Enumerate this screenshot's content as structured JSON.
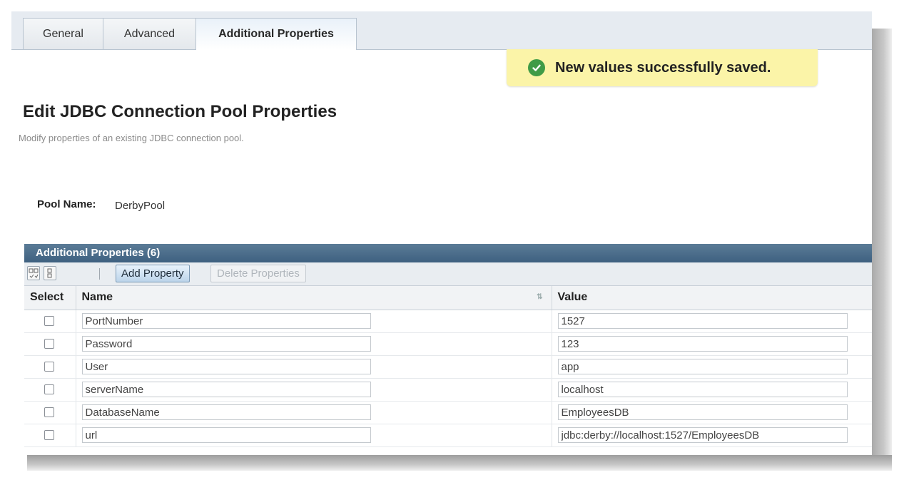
{
  "tabs": [
    {
      "label": "General"
    },
    {
      "label": "Advanced"
    },
    {
      "label": "Additional Properties",
      "active": true
    }
  ],
  "alert": {
    "message": "New values successfully saved.",
    "icon": "check-circle-icon",
    "color": "#3f9b46"
  },
  "page": {
    "title": "Edit JDBC Connection Pool Properties",
    "help": "Modify properties of an existing JDBC connection pool."
  },
  "pool": {
    "label": "Pool Name:",
    "value": "DerbyPool"
  },
  "table": {
    "title": "Additional Properties (6)",
    "toolbar": {
      "add_label": "Add Property",
      "delete_label": "Delete Properties"
    },
    "headers": {
      "select": "Select",
      "name": "Name",
      "value": "Value"
    },
    "rows": [
      {
        "name": "PortNumber",
        "value": "1527"
      },
      {
        "name": "Password",
        "value": "123"
      },
      {
        "name": "User",
        "value": "app"
      },
      {
        "name": "serverName",
        "value": "localhost"
      },
      {
        "name": "DatabaseName",
        "value": "EmployeesDB"
      },
      {
        "name": "url",
        "value": "jdbc:derby://localhost:1527/EmployeesDB"
      }
    ]
  }
}
